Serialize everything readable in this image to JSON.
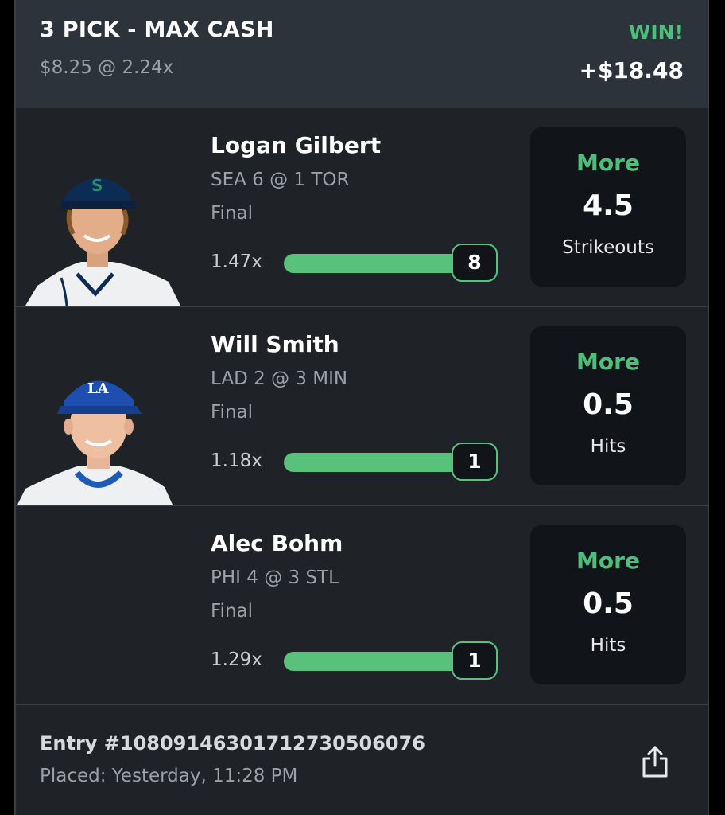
{
  "header": {
    "title": "3 PICK - MAX CASH",
    "stake": "$8.25 @ 2.24x",
    "result": "WIN!",
    "payout": "+$18.48"
  },
  "picks": [
    {
      "name": "Logan Gilbert",
      "game": "SEA 6 @ 1 TOR",
      "status": "Final",
      "multiplier": "1.47x",
      "actual": "8",
      "direction": "More",
      "line": "4.5",
      "stat": "Strikeouts",
      "progress": 1.0
    },
    {
      "name": "Will Smith",
      "game": "LAD 2 @ 3 MIN",
      "status": "Final",
      "multiplier": "1.18x",
      "actual": "1",
      "direction": "More",
      "line": "0.5",
      "stat": "Hits",
      "progress": 1.0
    },
    {
      "name": "Alec Bohm",
      "game": "PHI 4 @ 3 STL",
      "status": "Final",
      "multiplier": "1.29x",
      "actual": "1",
      "direction": "More",
      "line": "0.5",
      "stat": "Hits",
      "progress": 1.0
    }
  ],
  "footer": {
    "entry": "Entry #10809146301712730506076",
    "placed": "Placed: Yesterday, 11:28 PM"
  },
  "icons": {
    "share": "share-icon"
  },
  "colors": {
    "accent_green": "#4cc07a",
    "background": "#1f2328",
    "header": "#2c333b",
    "pick_box": "#111418"
  }
}
